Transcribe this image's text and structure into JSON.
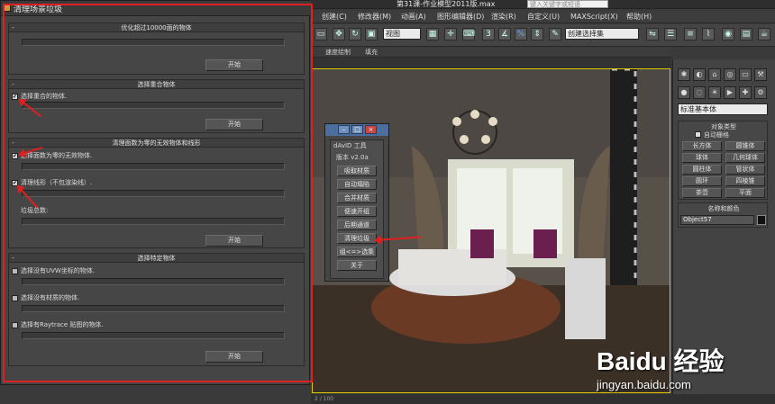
{
  "app": {
    "doc_title": "第31课-作业模型2011版.max",
    "search_placeholder": "键入关键字或短语"
  },
  "menu": [
    "创建(C)",
    "修改器(M)",
    "动画(A)",
    "图形编辑器(D)",
    "渲染(R)",
    "自定义(U)",
    "MAXScript(X)",
    "帮助(H)"
  ],
  "toolbar": {
    "view_dropdown": "视图",
    "selection_set_dropdown": "创建选择集",
    "num3": "3"
  },
  "subbar": {
    "left": "速度绘制",
    "right": "填充"
  },
  "dialog": {
    "title": "清理场景垃圾",
    "rollouts": [
      {
        "title": "优化超过10000面的物体",
        "button": "开始"
      },
      {
        "title": "选择重合物体",
        "checkbox_label": "选择重合的物体.",
        "checked": true,
        "button": "开始"
      },
      {
        "title": "清理面数为零的无效物体和线形",
        "items": [
          {
            "label": "选择面数为零的无效物体.",
            "checked": true
          },
          {
            "label": "清理线形（不包渲染线）.",
            "checked": true
          }
        ],
        "summary": "垃圾总数:",
        "button": "开始"
      },
      {
        "title": "选择特定物体",
        "items": [
          {
            "label": "选择没有UVW坐标的物体.",
            "checked": false
          },
          {
            "label": "选择没有材质的物体.",
            "checked": false
          },
          {
            "label": "选择有Raytrace 贴图的物体.",
            "checked": false
          }
        ],
        "button": "开始"
      }
    ]
  },
  "tool": {
    "header": "dAvID 工具",
    "version": "版本 v2.0a",
    "buttons": [
      "吸取材质",
      "自动塌陷",
      "合并材质",
      "便速开组",
      "后期通道",
      "清理垃圾",
      "组<=>选集",
      "关于"
    ]
  },
  "command_panel": {
    "dropdown": "标准基本体",
    "object_type_title": "对象类型",
    "autogrid": "自动栅格",
    "buttons": [
      "长方体",
      "圆锥体",
      "球体",
      "几何球体",
      "圆柱体",
      "管状体",
      "圆环",
      "四棱锥",
      "茶壶",
      "平面"
    ],
    "name_color_title": "名称和颜色",
    "object_name": "Object57"
  },
  "status": "2 / 100",
  "watermark": {
    "brand": "Baidu 经验",
    "url": "jingyan.baidu.com"
  }
}
